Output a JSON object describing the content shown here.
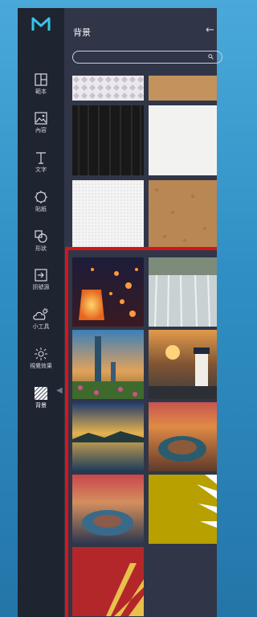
{
  "app": {
    "logo_icon": "brand-logo-icon"
  },
  "rail": {
    "items": [
      {
        "label": "範本",
        "icon": "template-icon"
      },
      {
        "label": "內容",
        "icon": "image-icon"
      },
      {
        "label": "文字",
        "icon": "text-icon"
      },
      {
        "label": "貼紙",
        "icon": "sticker-icon"
      },
      {
        "label": "形狀",
        "icon": "shape-icon"
      },
      {
        "label": "訊號源",
        "icon": "signal-source-icon"
      },
      {
        "label": "小工具",
        "icon": "widget-icon"
      },
      {
        "label": "視覺效果",
        "icon": "visual-effect-icon"
      },
      {
        "label": "背景",
        "icon": "background-icon",
        "active": true
      }
    ]
  },
  "panel": {
    "title": "背景",
    "search_placeholder": ""
  },
  "tiles": [
    {
      "name": "diamond-pattern-tile"
    },
    {
      "name": "kraft-paper-tile"
    },
    {
      "name": "dark-wood-tile"
    },
    {
      "name": "white-texture-tile"
    },
    {
      "name": "white-canvas-tile"
    },
    {
      "name": "cork-texture-tile"
    },
    {
      "name": "sky-lanterns-photo-tile"
    },
    {
      "name": "waterfall-photo-tile"
    },
    {
      "name": "taipei-101-photo-tile"
    },
    {
      "name": "lighthouse-sunset-photo-tile"
    },
    {
      "name": "lake-sunset-photo-tile"
    },
    {
      "name": "horseshoe-bend-photo-tile"
    },
    {
      "name": "horseshoe-bend-dusk-photo-tile"
    },
    {
      "name": "yellow-sunburst-tile"
    },
    {
      "name": "red-sunburst-tile"
    }
  ],
  "colors": {
    "highlight": "#d8141a",
    "rail_bg": "#1f2431",
    "panel_bg": "#303648"
  }
}
